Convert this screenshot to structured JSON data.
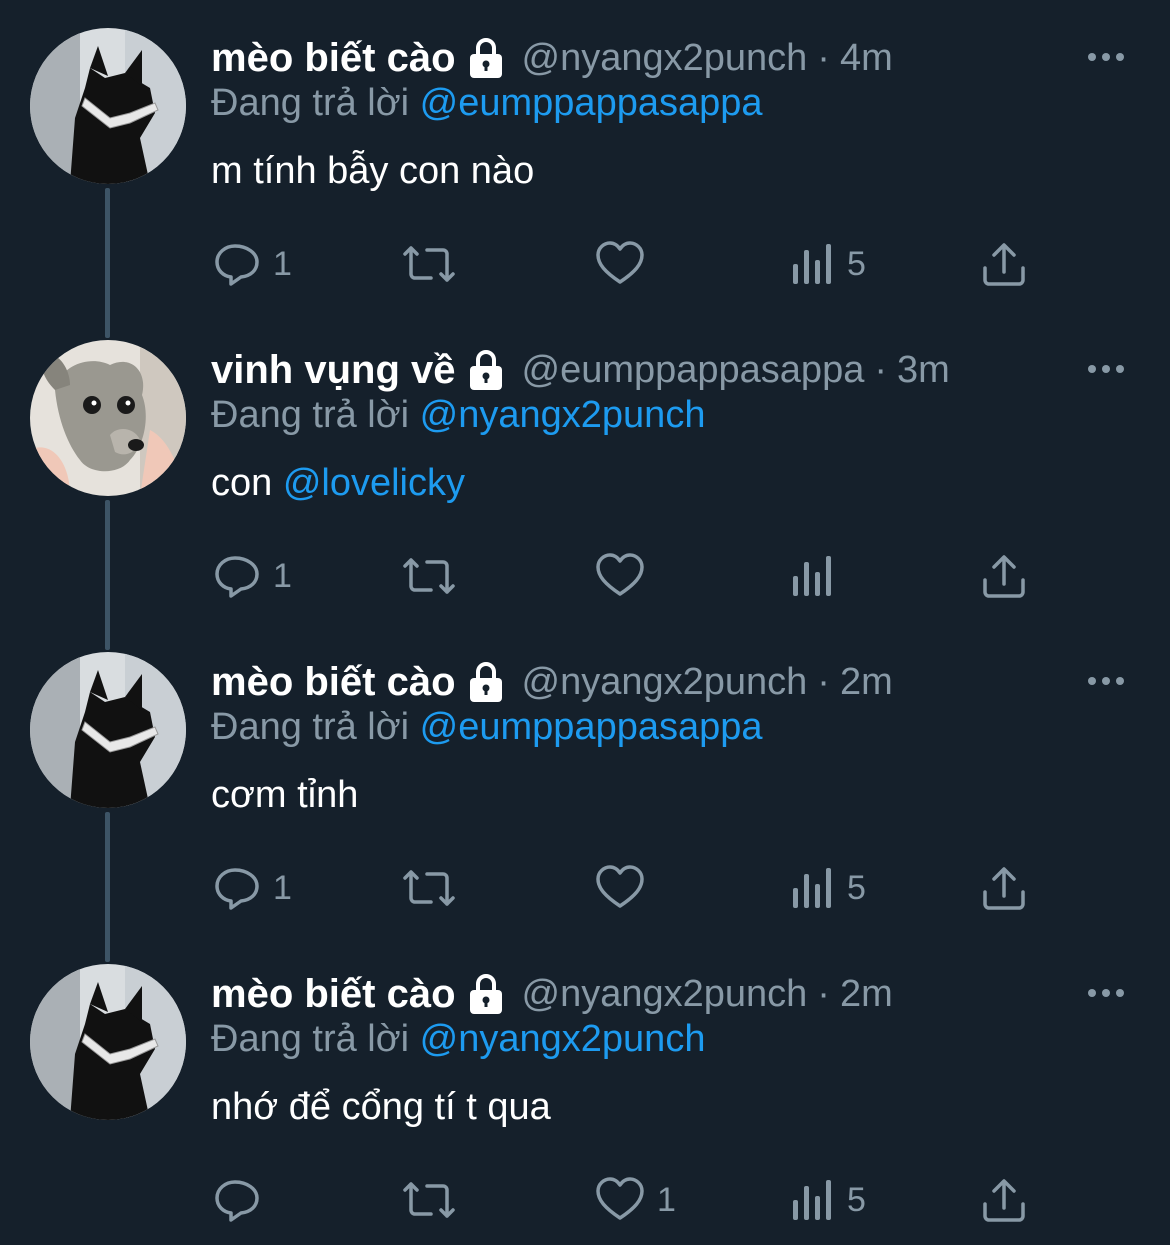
{
  "tweets": [
    {
      "name": "mèo biết cào",
      "handle": "@nyangx2punch",
      "separator": "·",
      "time": "4m",
      "replying_prefix": "Đang trả lời",
      "replying_to": "@eumppappasappa",
      "text": "m tính bẫy con nào",
      "text_mention": "",
      "avatar": "cat-sunglasses",
      "reply_count": "1",
      "retweet_count": "",
      "like_count": "",
      "views_count": "5"
    },
    {
      "name": "vinh vụng về",
      "handle": "@eumppappasappa",
      "separator": "·",
      "time": "3m",
      "replying_prefix": "Đang trả lời",
      "replying_to": "@nyangx2punch",
      "text": "con ",
      "text_mention": "@lovelicky",
      "avatar": "dog",
      "reply_count": "1",
      "retweet_count": "",
      "like_count": "",
      "views_count": ""
    },
    {
      "name": "mèo biết cào",
      "handle": "@nyangx2punch",
      "separator": "·",
      "time": "2m",
      "replying_prefix": "Đang trả lời",
      "replying_to": "@eumppappasappa",
      "text": "cơm tỉnh",
      "text_mention": "",
      "avatar": "cat-sunglasses",
      "reply_count": "1",
      "retweet_count": "",
      "like_count": "",
      "views_count": "5"
    },
    {
      "name": "mèo biết cào",
      "handle": "@nyangx2punch",
      "separator": "·",
      "time": "2m",
      "replying_prefix": "Đang trả lời",
      "replying_to": "@nyangx2punch",
      "text": "nhớ để cổng tí t qua",
      "text_mention": "",
      "avatar": "cat-sunglasses",
      "reply_count": "",
      "retweet_count": "",
      "like_count": "1",
      "views_count": "5"
    }
  ],
  "icons": {
    "lock": "lock-icon",
    "more": "more-icon",
    "reply": "reply-icon",
    "retweet": "retweet-icon",
    "like": "like-icon",
    "views": "views-icon",
    "share": "share-icon"
  },
  "colors": {
    "background": "#15202b",
    "text_primary": "#ffffff",
    "text_secondary": "#8899a6",
    "mention": "#1d9bf0",
    "thread_line": "#3d5466"
  }
}
